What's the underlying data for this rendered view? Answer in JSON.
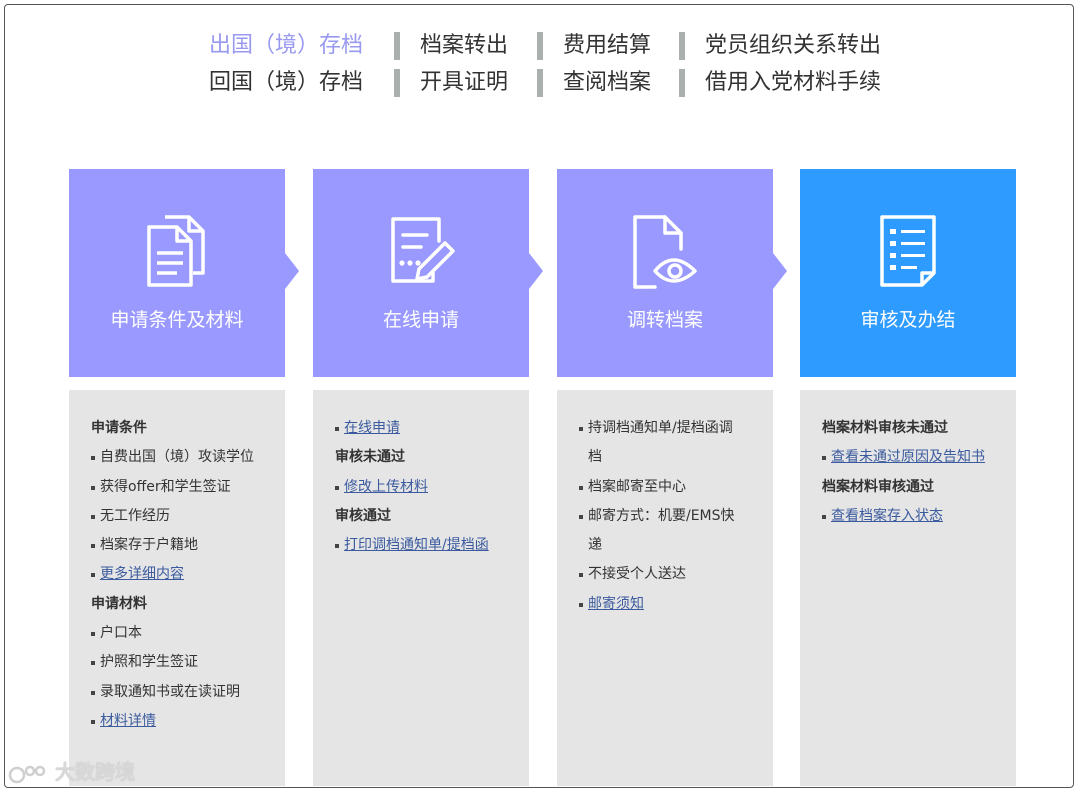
{
  "nav": {
    "row1": [
      "出国（境）存档",
      "档案转出",
      "费用结算",
      "党员组织关系转出"
    ],
    "row2": [
      "回国（境）存档",
      "开具证明",
      "查阅档案",
      "借用入党材料手续"
    ],
    "active": "出国（境）存档"
  },
  "steps": [
    {
      "label": "申请条件及材料",
      "icon": "documents-icon"
    },
    {
      "label": "在线申请",
      "icon": "edit-form-icon"
    },
    {
      "label": "调转档案",
      "icon": "file-view-icon"
    },
    {
      "label": "审核及办结",
      "icon": "checklist-icon"
    }
  ],
  "colors": {
    "step": "#9999ff",
    "step_final": "#2d9bff",
    "active_nav": "#9999f0",
    "link": "#3b5b9e",
    "panel": "#e5e5e5"
  },
  "panels": {
    "p1": {
      "h1": "申请条件",
      "i1": "自费出国（境）攻读学位",
      "i2": "获得offer和学生签证",
      "i3": "无工作经历",
      "i4": "档案存于户籍地",
      "l1": "更多详细内容",
      "h2": "申请材料",
      "i5": "户口本",
      "i6": "护照和学生签证",
      "i7": "录取通知书或在读证明",
      "l2": "材料详情"
    },
    "p2": {
      "l1": "在线申请",
      "h1": "审核未通过",
      "l2": "修改上传材料",
      "h2": "审核通过",
      "l3": "打印调档通知单/提档函"
    },
    "p3": {
      "i1a": "持调档通知单/提档函调",
      "i1b": "档",
      "i2": "档案邮寄至中心",
      "i3a": "邮寄方式：机要/EMS快",
      "i3b": "递",
      "i4": "不接受个人送达",
      "l1": "邮寄须知"
    },
    "p4": {
      "h1": "档案材料审核未通过",
      "l1": "查看未通过原因及告知书",
      "h2": "档案材料审核通过",
      "l2": "查看档案存入状态"
    }
  },
  "watermark": "大数跨境"
}
